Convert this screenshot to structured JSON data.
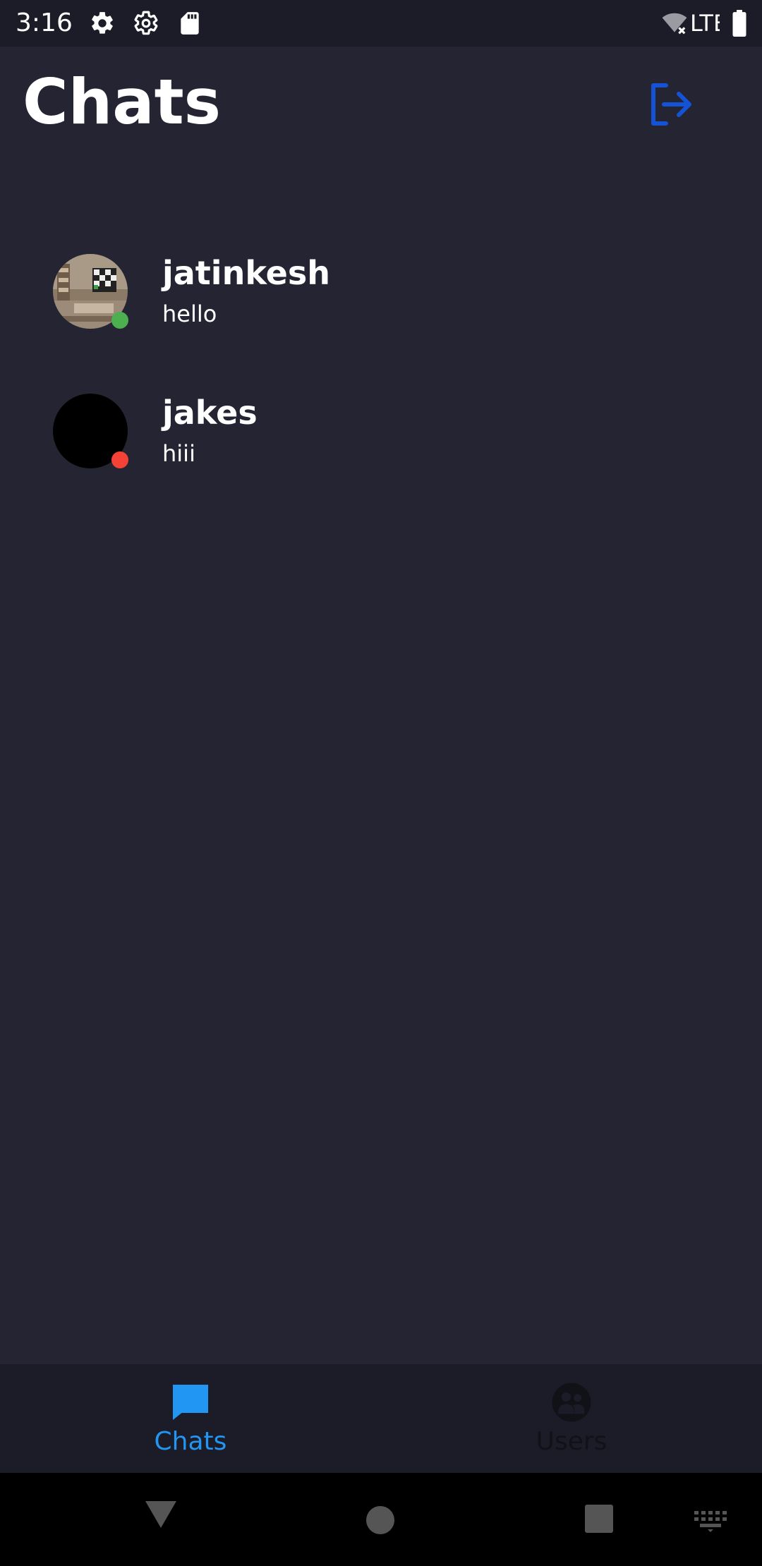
{
  "status_bar": {
    "time": "3:16",
    "icons": [
      "settings-icon",
      "settings-icon",
      "sd-card-icon",
      "wifi-off-icon",
      "battery-icon"
    ],
    "network": "LTE"
  },
  "header": {
    "title": "Chats",
    "logout_icon": "logout-icon",
    "accent_color": "#1452d6"
  },
  "chats": [
    {
      "name": "jatinkesh",
      "last_message": "hello",
      "status": "online",
      "status_color": "#4caf50",
      "avatar": "photo"
    },
    {
      "name": "jakes",
      "last_message": "hiii",
      "status": "offline",
      "status_color": "#f44336",
      "avatar": "blank"
    }
  ],
  "bottom_nav": {
    "tabs": [
      {
        "label": "Chats",
        "icon": "chat-bubble-icon",
        "active": true,
        "color": "#2196f3"
      },
      {
        "label": "Users",
        "icon": "users-icon",
        "active": false,
        "color": "#111118"
      }
    ]
  },
  "system_nav": [
    "back-icon",
    "home-icon",
    "recents-icon",
    "keyboard-icon"
  ]
}
